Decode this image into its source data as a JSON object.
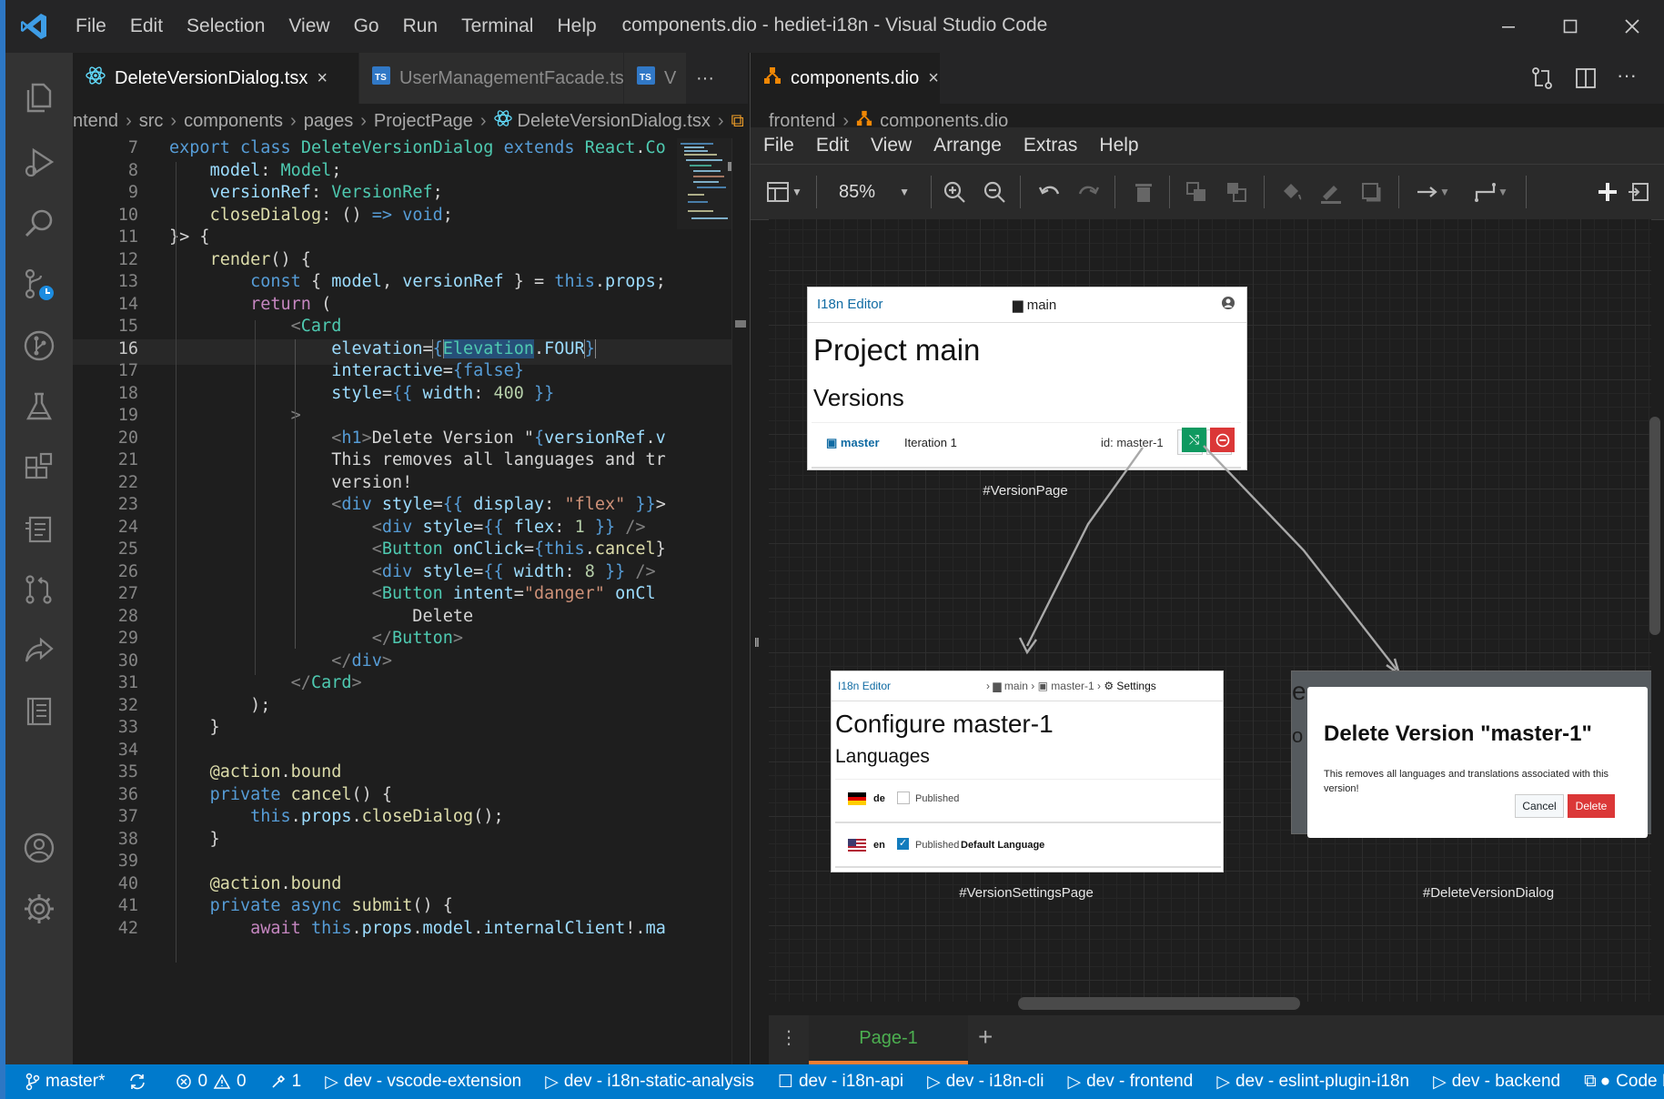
{
  "window": {
    "title": "components.dio - hediet-i18n - Visual Studio Code",
    "menu": [
      "File",
      "Edit",
      "Selection",
      "View",
      "Go",
      "Run",
      "Terminal",
      "Help"
    ]
  },
  "left_editor": {
    "tabs": [
      {
        "label": "DeleteVersionDialog.tsx",
        "close": "×"
      },
      {
        "label": "UserManagementFacade.ts"
      },
      {
        "label": "V"
      }
    ],
    "tabs_more": "···",
    "breadcrumb": [
      "ntend",
      "src",
      "components",
      "pages",
      "ProjectPage",
      "DeleteVersionDialog.tsx"
    ],
    "line_numbers": [
      "7",
      "8",
      "9",
      "10",
      "11",
      "12",
      "13",
      "14",
      "15",
      "16",
      "17",
      "18",
      "19",
      "20",
      "21",
      "22",
      "23",
      "24",
      "25",
      "26",
      "27",
      "28",
      "29",
      "30",
      "31",
      "32",
      "33",
      "34",
      "35",
      "36",
      "37",
      "38",
      "39",
      "40",
      "41",
      "42"
    ]
  },
  "right_editor": {
    "tab": {
      "label": "components.dio",
      "close": "×"
    },
    "breadcrumb": [
      "frontend",
      "components.dio"
    ],
    "drawio_menu": [
      "File",
      "Edit",
      "View",
      "Arrange",
      "Extras",
      "Help"
    ],
    "zoom": "85%",
    "page_tab": "Page-1",
    "add_page": "+",
    "diagram": {
      "version_page": {
        "app_name": "I18n Editor",
        "folder": "main",
        "heading": "Project main",
        "subheading": "Versions",
        "version_name": "master",
        "iteration": "Iteration 1",
        "id": "id: master-1",
        "caption": "#VersionPage"
      },
      "settings_page": {
        "app_name": "I18n Editor",
        "crumb_main": "main",
        "crumb_version": "master-1",
        "crumb_settings": "Settings",
        "heading": "Configure master-1",
        "subheading": "Languages",
        "languages": [
          {
            "code": "de",
            "published_label": "Published",
            "published": false,
            "default": ""
          },
          {
            "code": "en",
            "published_label": "Published",
            "published": true,
            "default": "Default Language"
          }
        ],
        "caption": "#VersionSettingsPage"
      },
      "delete_dialog": {
        "title": "Delete Version \"master-1\"",
        "body": "This removes all languages and translations associated with this version!",
        "cancel": "Cancel",
        "delete": "Delete",
        "caption": "#DeleteVersionDialog"
      }
    }
  },
  "statusbar": {
    "branch": "master*",
    "errors": "0",
    "warnings": "0",
    "tools": "1",
    "tasks": [
      "dev - vscode-extension",
      "dev - i18n-static-analysis",
      "dev - i18n-api",
      "dev - i18n-cli",
      "dev - frontend",
      "dev - eslint-plugin-i18n",
      "dev - backend"
    ],
    "code_link": "Code Lin"
  },
  "colors": {
    "accent": "#007acc",
    "activity_bar": "#333333",
    "editor_bg": "#1e1e1e",
    "delete_red": "#db3737",
    "merge_green": "#0f9960",
    "link_blue": "#106ba3",
    "page_tab_green": "#4caf50"
  }
}
